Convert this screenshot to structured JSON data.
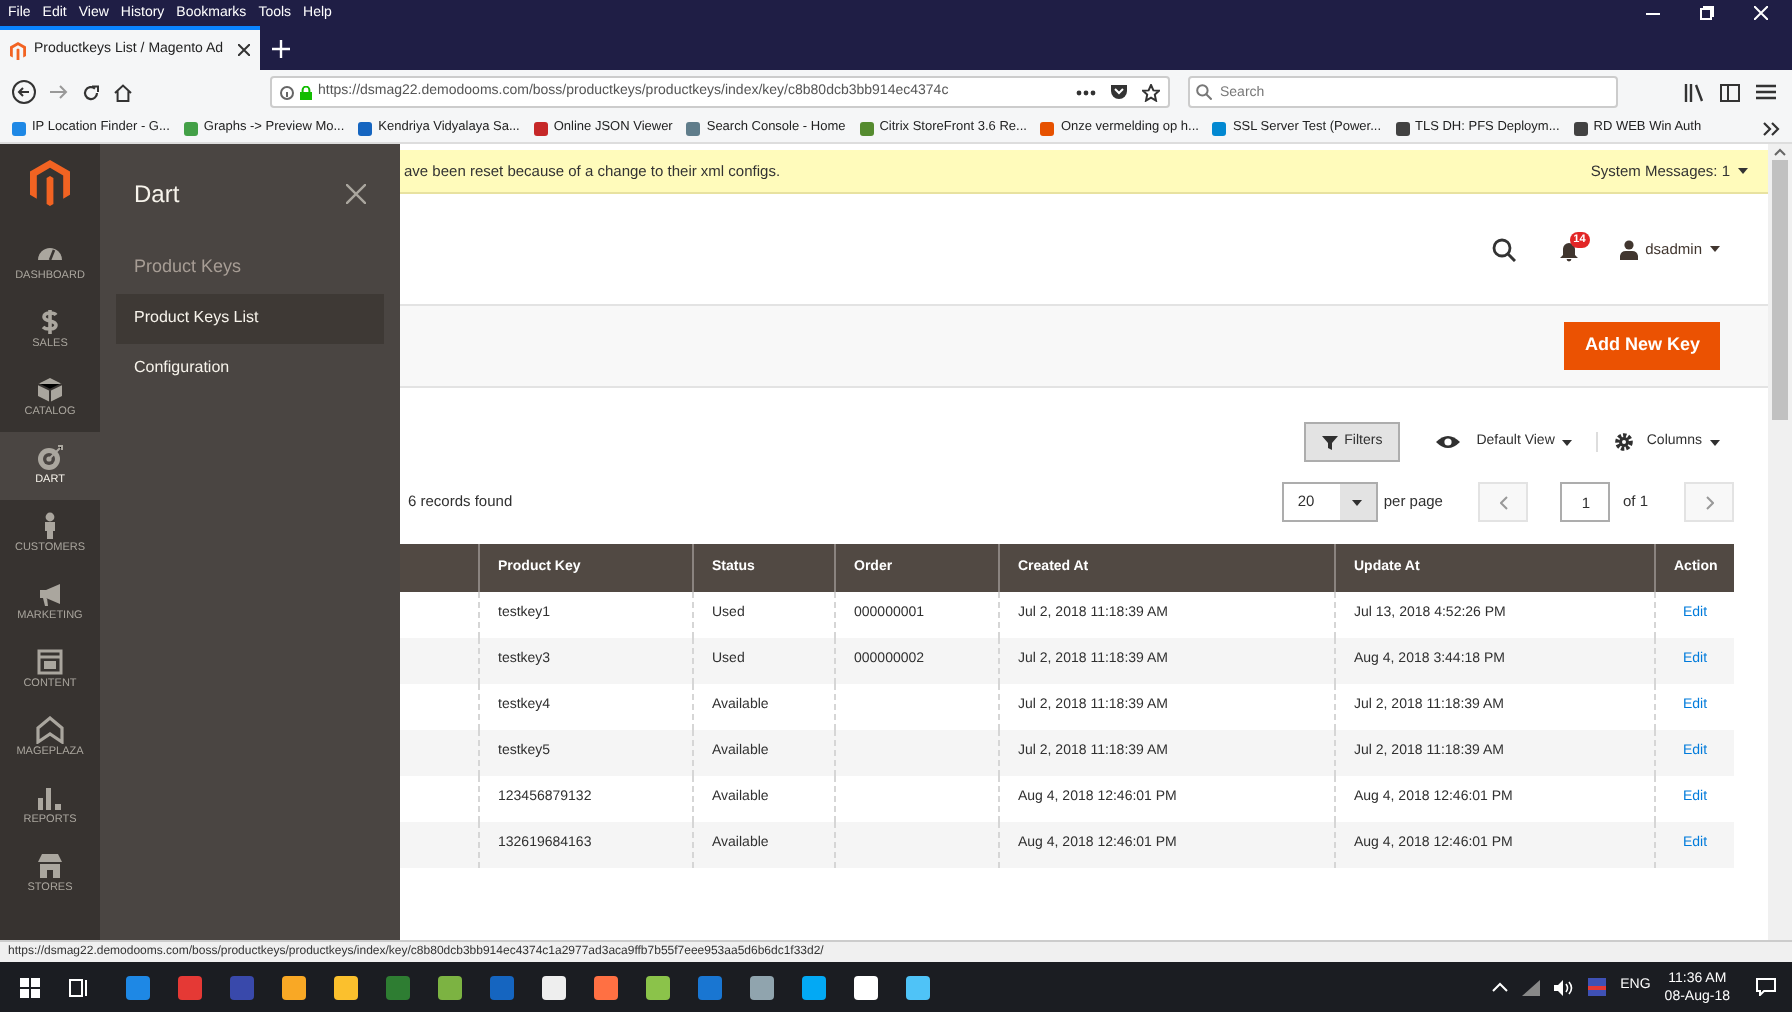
{
  "browser": {
    "menu": [
      "File",
      "Edit",
      "View",
      "History",
      "Bookmarks",
      "Tools",
      "Help"
    ],
    "tab": {
      "title": "Productkeys List / Magento Ad",
      "selected": true
    },
    "url": "https://dsmag22.demodooms.com/boss/productkeys/productkeys/index/key/c8b80dcb3bb914ec4374c",
    "search": {
      "placeholder": "Search"
    },
    "bookmarks": [
      {
        "label": "IP Location Finder - G...",
        "color": "#1e88e5"
      },
      {
        "label": "Graphs -> Preview Mo...",
        "color": "#43a047"
      },
      {
        "label": "Kendriya Vidyalaya Sa...",
        "color": "#1565c0"
      },
      {
        "label": "Online JSON Viewer",
        "color": "#c62828"
      },
      {
        "label": "Search Console - Home",
        "color": "#607d8b"
      },
      {
        "label": "Citrix StoreFront 3.6 Re...",
        "color": "#558b2f"
      },
      {
        "label": "Onze vermelding op h...",
        "color": "#e65100"
      },
      {
        "label": "SSL Server Test (Power...",
        "color": "#0288d1"
      },
      {
        "label": "TLS DH: PFS Deploym...",
        "color": "#424242"
      },
      {
        "label": "RD WEB Win Auth",
        "color": "#424242"
      }
    ]
  },
  "admin": {
    "nav": [
      {
        "label": "DASHBOARD",
        "kind": "dashboard",
        "selected": false
      },
      {
        "label": "SALES",
        "kind": "sales",
        "selected": false
      },
      {
        "label": "CATALOG",
        "kind": "catalog",
        "selected": false
      },
      {
        "label": "DART",
        "kind": "dart",
        "selected": true
      },
      {
        "label": "CUSTOMERS",
        "kind": "customers",
        "selected": false
      },
      {
        "label": "MARKETING",
        "kind": "marketing",
        "selected": false
      },
      {
        "label": "CONTENT",
        "kind": "content",
        "selected": false
      },
      {
        "label": "MAGEPLAZA",
        "kind": "mageplaza",
        "selected": false
      },
      {
        "label": "REPORTS",
        "kind": "reports",
        "selected": false
      },
      {
        "label": "STORES",
        "kind": "stores",
        "selected": false
      }
    ],
    "flyout": {
      "title": "Dart",
      "section": "Product Keys",
      "items": [
        {
          "label": "Product Keys List",
          "selected": true
        },
        {
          "label": "Configuration",
          "selected": false
        }
      ]
    },
    "message": "ave been reset because of a change to their xml configs.",
    "system_messages": "System Messages: 1",
    "notifications": "14",
    "user": "dsadmin",
    "add_button": "Add New Key",
    "filters": "Filters",
    "view": "Default View",
    "columns_button": "Columns",
    "records": "6 records found",
    "per_page_value": "20",
    "per_page_label": "per page",
    "page": "1",
    "page_total": "of 1",
    "table": {
      "columns": [
        "Product Key",
        "Status",
        "Order",
        "Created At",
        "Update At",
        "Action"
      ],
      "rows": [
        [
          "testkey1",
          "Used",
          "000000001",
          "Jul 2, 2018 11:18:39 AM",
          "Jul 13, 2018 4:52:26 PM",
          "Edit"
        ],
        [
          "testkey3",
          "Used",
          "000000002",
          "Jul 2, 2018 11:18:39 AM",
          "Aug 4, 2018 3:44:18 PM",
          "Edit"
        ],
        [
          "testkey4",
          "Available",
          "",
          "Jul 2, 2018 11:18:39 AM",
          "Jul 2, 2018 11:18:39 AM",
          "Edit"
        ],
        [
          "testkey5",
          "Available",
          "",
          "Jul 2, 2018 11:18:39 AM",
          "Jul 2, 2018 11:18:39 AM",
          "Edit"
        ],
        [
          "123456879132",
          "Available",
          "",
          "Aug 4, 2018 12:46:01 PM",
          "Aug 4, 2018 12:46:01 PM",
          "Edit"
        ],
        [
          "132619684163",
          "Available",
          "",
          "Aug 4, 2018 12:46:01 PM",
          "Aug 4, 2018 12:46:01 PM",
          "Edit"
        ]
      ]
    }
  },
  "status_url": "https://dsmag22.demodooms.com/boss/productkeys/productkeys/index/key/c8b80dcb3bb914ec4374c1a2977ad3aca9ffb7b55f7eee953aa5d6b6dc1f33d2/",
  "taskbar": {
    "apps": [
      {
        "color": "#1e88e5"
      },
      {
        "color": "#e53935"
      },
      {
        "color": "#3949ab"
      },
      {
        "color": "#f9a825"
      },
      {
        "color": "#fbc02d"
      },
      {
        "color": "#2e7d32"
      },
      {
        "color": "#7cb342"
      },
      {
        "color": "#1565c0"
      },
      {
        "color": "#eeeeee"
      },
      {
        "color": "#ff7043"
      },
      {
        "color": "#8bc34a"
      },
      {
        "color": "#1976d2"
      },
      {
        "color": "#90a4ae"
      },
      {
        "color": "#03a9f4"
      },
      {
        "color": "#ffffff"
      },
      {
        "color": "#4fc3f7"
      }
    ],
    "language": "ENG",
    "time": "11:36 AM",
    "date": "08-Aug-18"
  }
}
